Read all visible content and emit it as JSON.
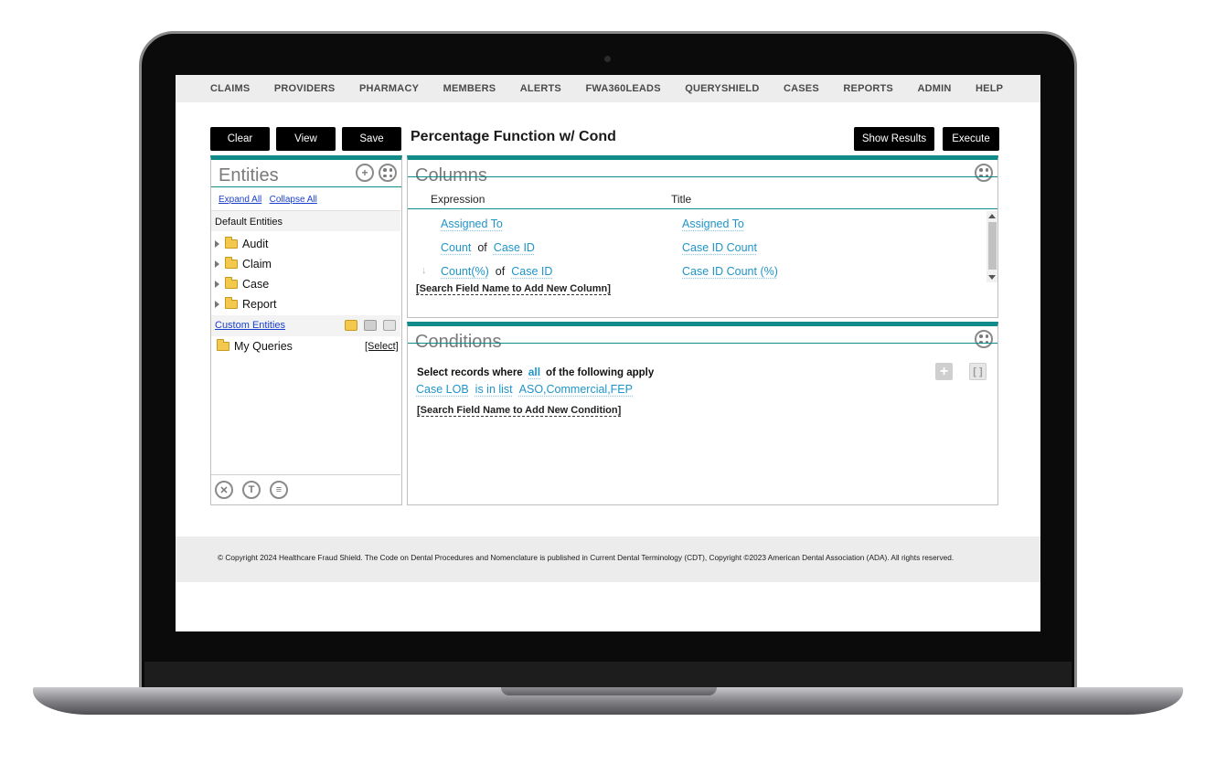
{
  "nav": {
    "items": [
      "CLAIMS",
      "PROVIDERS",
      "PHARMACY",
      "MEMBERS",
      "ALERTS",
      "FWA360LEADS",
      "QUERYSHIELD",
      "CASES",
      "REPORTS",
      "ADMIN",
      "HELP"
    ]
  },
  "toolbar": {
    "clear_label": "Clear",
    "view_label": "View",
    "save_label": "Save",
    "show_results_label": "Show Results",
    "execute_label": "Execute"
  },
  "query_title": "Percentage Function w/ Cond",
  "entities": {
    "title": "Entities",
    "expand_all": "Expand All",
    "collapse_all": "Collapse All",
    "default_label": "Default Entities",
    "items": [
      "Audit",
      "Claim",
      "Case",
      "Report"
    ],
    "custom_label": "Custom Entities",
    "my_queries": "My Queries",
    "select_label": "[Select]"
  },
  "columns": {
    "title": "Columns",
    "expression_header": "Expression",
    "title_header": "Title",
    "rows": [
      {
        "func": "",
        "of": "",
        "field": "Assigned To",
        "title": "Assigned To"
      },
      {
        "func": "Count",
        "of": "of",
        "field": "Case ID",
        "title": "Case ID Count"
      },
      {
        "func": "Count(%)",
        "of": "of",
        "field": "Case ID",
        "title": "Case ID Count (%)"
      }
    ],
    "add_label": "[Search Field Name to Add New Column]"
  },
  "conditions": {
    "title": "Conditions",
    "prefix": "Select records where",
    "quantifier": "all",
    "suffix": "of the following apply",
    "condition": {
      "field": "Case LOB",
      "operator": "is in list",
      "value": "ASO,Commercial,FEP"
    },
    "add_label": "[Search Field Name to Add New Condition]"
  },
  "footer": {
    "copyright": "© Copyright 2024 Healthcare Fraud Shield. The Code on Dental Procedures and Nomenclature is published in Current Dental Terminology (CDT), Copyright ©2023 American Dental Association (ADA). All rights reserved."
  },
  "colors": {
    "accent": "#118a8a",
    "link": "#1f94c8",
    "button": "#000000"
  }
}
